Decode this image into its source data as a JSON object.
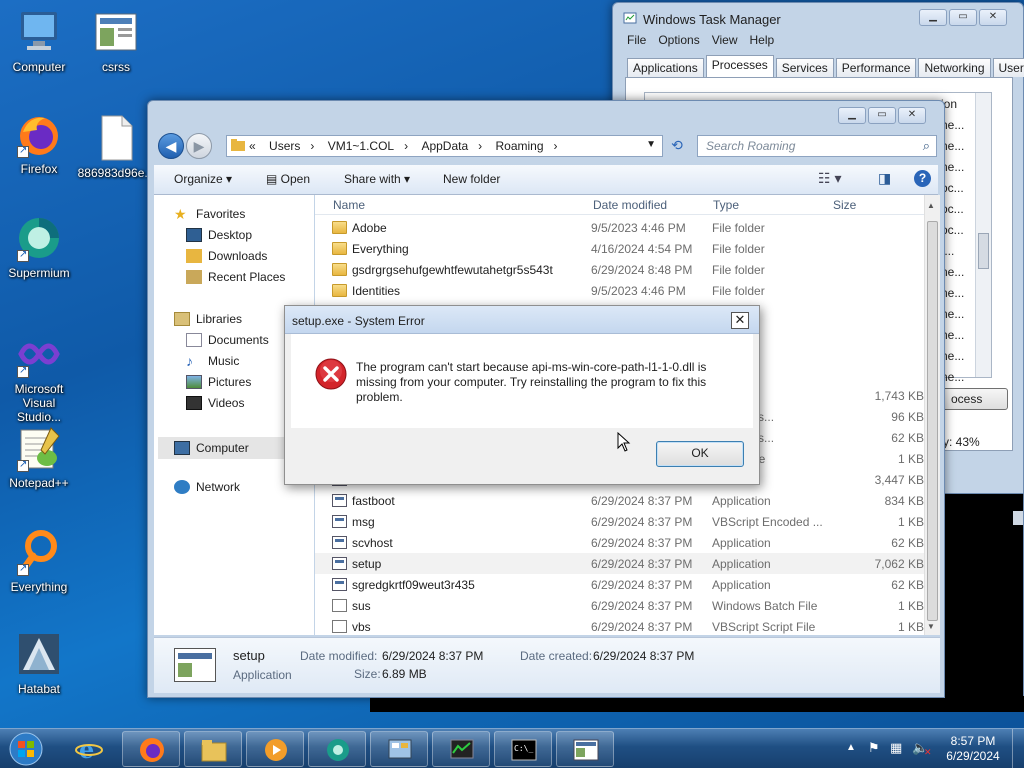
{
  "desktop": {
    "icons": [
      {
        "label": "Computer"
      },
      {
        "label": "csrss"
      },
      {
        "label": "Firefox"
      },
      {
        "label": "886983d96e..."
      },
      {
        "label": "Supermium"
      },
      {
        "label": "Microsoft Visual Studio..."
      },
      {
        "label": "Notepad++"
      },
      {
        "label": "Everything"
      },
      {
        "label": "Hatabat"
      }
    ]
  },
  "task_manager": {
    "title": "Windows Task Manager",
    "menu": [
      "File",
      "Options",
      "View",
      "Help"
    ],
    "tabs": [
      "Applications",
      "Processes",
      "Services",
      "Performance",
      "Networking",
      "Users"
    ],
    "active_tab": "Processes",
    "partial_rows": [
      "ion",
      "ne...",
      "ne...",
      "ne...",
      "oc...",
      "oc...",
      "oc...",
      "t...",
      "ne...",
      "ne...",
      "ne...",
      "ne...",
      "ne...",
      "ne...",
      "ne..."
    ],
    "end_process_label": "ocess",
    "status_text": "y: 43%"
  },
  "explorer": {
    "breadcrumb": [
      "«",
      "Users",
      "VM1~1.COL",
      "AppData",
      "Roaming"
    ],
    "search_placeholder": "Search Roaming",
    "toolbar": {
      "organize": "Organize",
      "open": "Open",
      "share_with": "Share with",
      "new_folder": "New folder"
    },
    "nav": {
      "favorites": "Favorites",
      "desktop": "Desktop",
      "downloads": "Downloads",
      "recent_places": "Recent Places",
      "libraries": "Libraries",
      "documents": "Documents",
      "music": "Music",
      "pictures": "Pictures",
      "videos": "Videos",
      "computer": "Computer",
      "network": "Network"
    },
    "columns": {
      "name": "Name",
      "date": "Date modified",
      "type": "Type",
      "size": "Size"
    },
    "files": [
      {
        "name": "Adobe",
        "date": "9/5/2023 4:46 PM",
        "type": "File folder",
        "size": "",
        "icon": "folder"
      },
      {
        "name": "Everything",
        "date": "4/16/2024 4:54 PM",
        "type": "File folder",
        "size": "",
        "icon": "folder"
      },
      {
        "name": "gsdrgrgsehufgewhtfewutahetgr5s543t",
        "date": "6/29/2024 8:48 PM",
        "type": "File folder",
        "size": "",
        "icon": "folder"
      },
      {
        "name": "Identities",
        "date": "9/5/2023 4:46 PM",
        "type": "File folder",
        "size": "",
        "icon": "folder"
      },
      {
        "name": "",
        "date": "",
        "type": "er",
        "size": "",
        "icon": "folder"
      },
      {
        "name": "",
        "date": "",
        "type": "er",
        "size": "",
        "icon": "folder"
      },
      {
        "name": "",
        "date": "",
        "type": "er",
        "size": "",
        "icon": "folder"
      },
      {
        "name": "",
        "date": "",
        "type": "er",
        "size": "",
        "icon": "folder"
      },
      {
        "name": "",
        "date": "",
        "type": "on",
        "size": "1,743 KB",
        "icon": "app"
      },
      {
        "name": "",
        "date": "",
        "type": "on extens...",
        "size": "96 KB",
        "icon": "app"
      },
      {
        "name": "",
        "date": "",
        "type": "on extens...",
        "size": "62 KB",
        "icon": "app"
      },
      {
        "name": "",
        "date": "",
        "type": "Batch File",
        "size": "1 KB",
        "icon": "script"
      },
      {
        "name": "",
        "date": "",
        "type": "on",
        "size": "3,447 KB",
        "icon": "app"
      },
      {
        "name": "fastboot",
        "date": "6/29/2024 8:37 PM",
        "type": "Application",
        "size": "834 KB",
        "icon": "app"
      },
      {
        "name": "msg",
        "date": "6/29/2024 8:37 PM",
        "type": "VBScript Encoded ...",
        "size": "1 KB",
        "icon": "app"
      },
      {
        "name": "scvhost",
        "date": "6/29/2024 8:37 PM",
        "type": "Application",
        "size": "62 KB",
        "icon": "app"
      },
      {
        "name": "setup",
        "date": "6/29/2024 8:37 PM",
        "type": "Application",
        "size": "7,062 KB",
        "icon": "app"
      },
      {
        "name": "sgredgkrtf09weut3r435",
        "date": "6/29/2024 8:37 PM",
        "type": "Application",
        "size": "62 KB",
        "icon": "app"
      },
      {
        "name": "sus",
        "date": "6/29/2024 8:37 PM",
        "type": "Windows Batch File",
        "size": "1 KB",
        "icon": "script"
      },
      {
        "name": "vbs",
        "date": "6/29/2024 8:37 PM",
        "type": "VBScript Script File",
        "size": "1 KB",
        "icon": "script"
      }
    ],
    "selected_file": "setup",
    "details": {
      "name": "setup",
      "type": "Application",
      "modified_label": "Date modified:",
      "modified_value": "6/29/2024 8:37 PM",
      "created_label": "Date created:",
      "created_value": "6/29/2024 8:37 PM",
      "size_label": "Size:",
      "size_value": "6.89 MB"
    }
  },
  "error_dialog": {
    "title": "setup.exe - System Error",
    "message": "The program can't start because api-ms-win-core-path-l1-1-0.dll is missing from your computer. Try reinstalling the program to fix this problem.",
    "ok_label": "OK"
  },
  "taskbar": {
    "time": "8:57 PM",
    "date": "6/29/2024"
  },
  "colors": {
    "error_red": "#d3242a",
    "selection": "#f2f2f2",
    "taskbar": "#1f4f83"
  }
}
